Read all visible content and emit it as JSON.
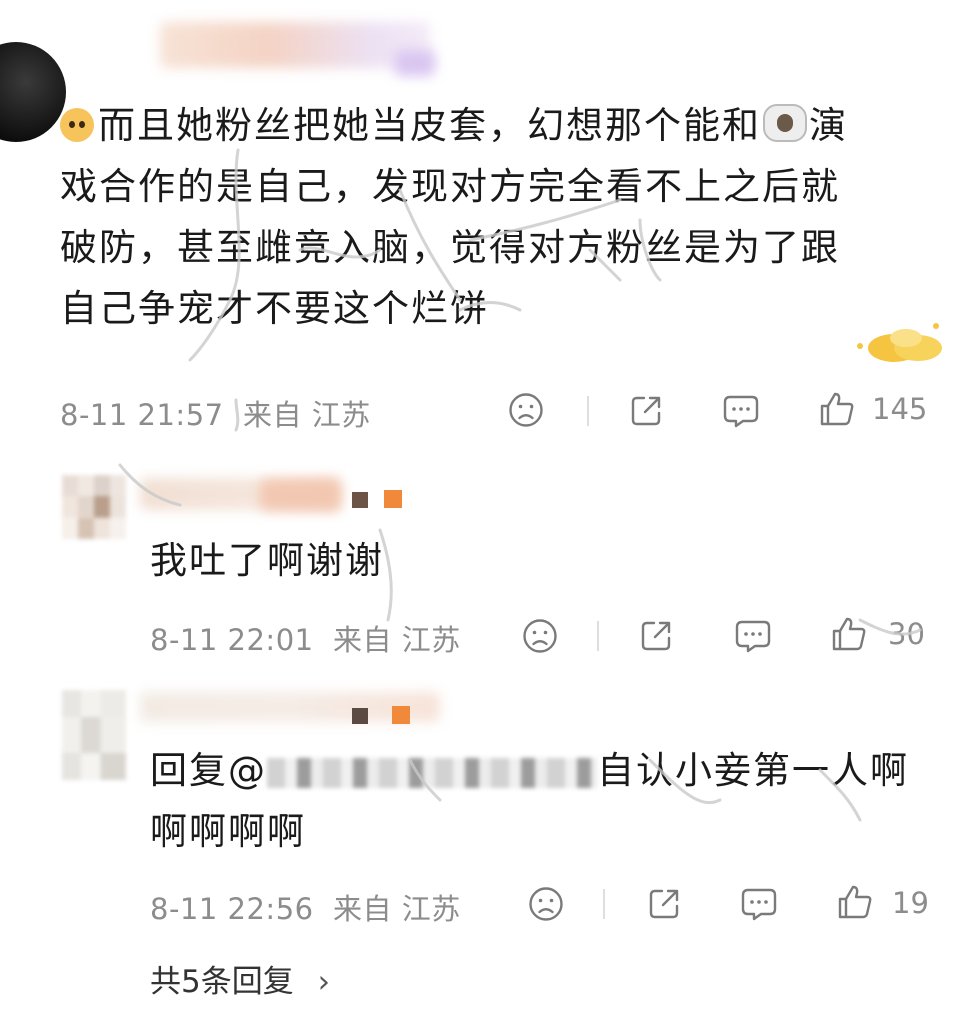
{
  "comments": [
    {
      "text_lines": [
        "而且她粉丝把她当皮套，幻想那个能和",
        "演",
        "戏合作的是自己，发现对方完全看不上之后就",
        "破防，甚至雌竞入脑，觉得对方粉丝是为了跟",
        "自己争宠才不要这个烂饼"
      ],
      "time": "8-11 21:57",
      "location": "来自 江苏",
      "likes": "145"
    },
    {
      "text": "我吐了啊谢谢",
      "time": "8-11 22:01",
      "location": "来自 江苏",
      "likes": "30"
    },
    {
      "reply_prefix": "回复@",
      "reply_suffix": "自认小妾第一人啊",
      "reply_line2": "啊啊啊啊",
      "time": "8-11 22:56",
      "location": "来自 江苏",
      "likes": "19"
    }
  ],
  "more_replies": "共5条回复",
  "more_replies_chevron": "›",
  "icons": {
    "emoji_1": "dog-face-emoji-icon",
    "emoji_2": "sheep-emoji-icon",
    "badge": "coins-badge-icon",
    "dislike": "sad-face-icon",
    "share": "share-icon",
    "comment": "comment-icon",
    "like": "thumbs-up-icon"
  },
  "colors": {
    "text": "#1a1a1a",
    "meta": "#8c8c8c",
    "badge": "#f5c542",
    "accent_orange": "#f08a3a"
  }
}
